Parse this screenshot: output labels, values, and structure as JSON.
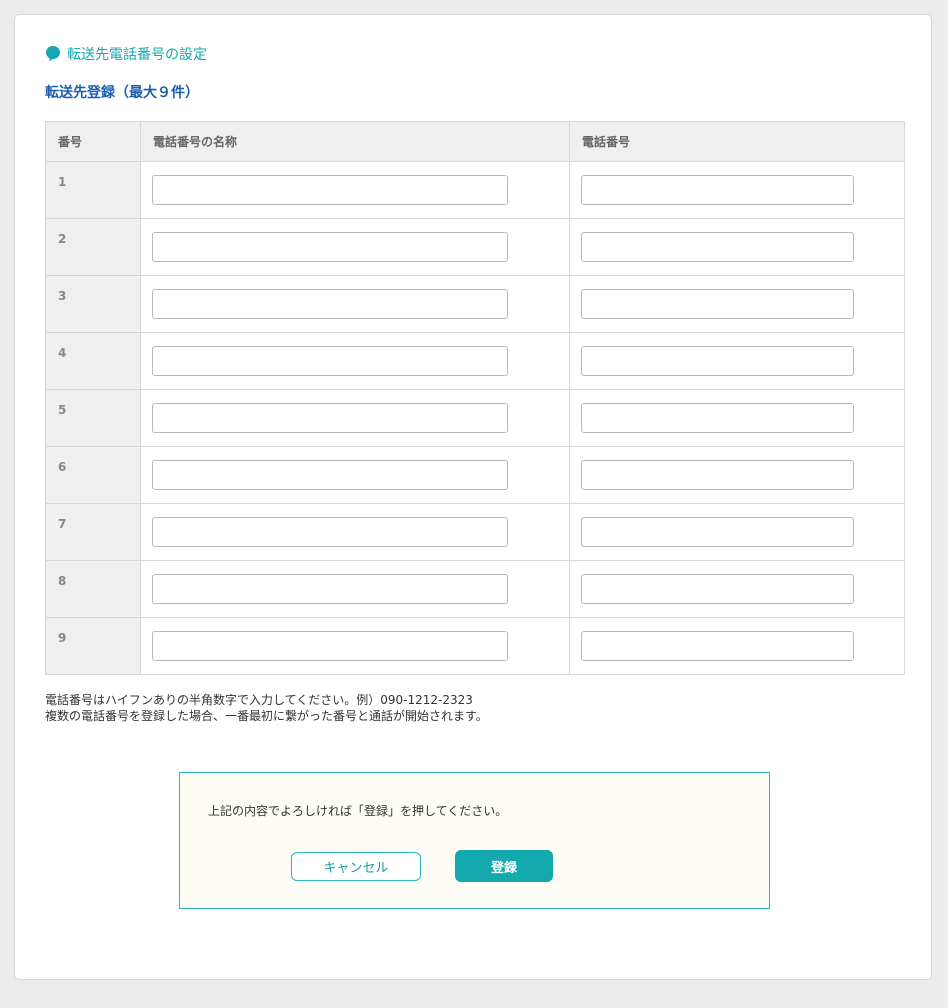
{
  "section_title": "転送先電話番号の設定",
  "sub_title": "転送先登録（最大９件）",
  "table": {
    "headers": [
      "番号",
      "電話番号の名称",
      "電話番号"
    ],
    "rows": [
      {
        "num": "1",
        "name_value": "",
        "phone_value": ""
      },
      {
        "num": "2",
        "name_value": "",
        "phone_value": ""
      },
      {
        "num": "3",
        "name_value": "",
        "phone_value": ""
      },
      {
        "num": "4",
        "name_value": "",
        "phone_value": ""
      },
      {
        "num": "5",
        "name_value": "",
        "phone_value": ""
      },
      {
        "num": "6",
        "name_value": "",
        "phone_value": ""
      },
      {
        "num": "7",
        "name_value": "",
        "phone_value": ""
      },
      {
        "num": "8",
        "name_value": "",
        "phone_value": ""
      },
      {
        "num": "9",
        "name_value": "",
        "phone_value": ""
      }
    ]
  },
  "notes": [
    "電話番号はハイフンありの半角数字で入力してください。例）090-1212-2323",
    "複数の電話番号を登録した場合、一番最初に繋がった番号と通話が開始されます。"
  ],
  "confirm": {
    "message": "上記の内容でよろしければ「登録」を押してください。",
    "cancel_label": "キャンセル",
    "register_label": "登録"
  },
  "colors": {
    "accent": "#15a8b0",
    "subtitle": "#1a5fae",
    "button": "#13a9ae",
    "confirm_bg": "#fdfdf5"
  },
  "icons": {
    "section": "speech-bubble-icon"
  }
}
